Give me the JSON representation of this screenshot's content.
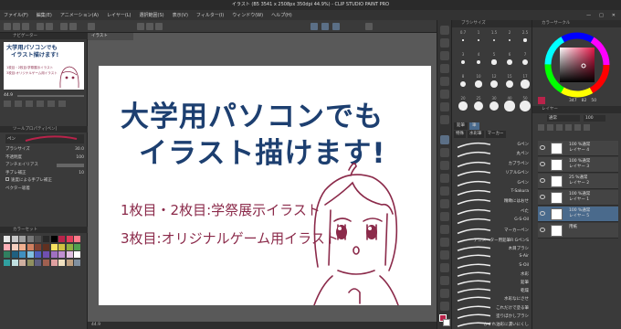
{
  "titlebar": {
    "text": "イラスト (B5 3541 x 2508px 350dpi 44.9%) - CLIP STUDIO PAINT PRO"
  },
  "menu": [
    "ファイル(F)",
    "編集(E)",
    "アニメーション(A)",
    "レイヤー(L)",
    "選択範囲(S)",
    "表示(V)",
    "フィルター(I)",
    "ウィンドウ(W)",
    "ヘルプ(H)"
  ],
  "left": {
    "navigator_title": "ナビゲーター",
    "tool_property_title": "ツールプロパティ[ペン]",
    "sub_tool_label": "ペン",
    "brush_size_label": "ブラシサイズ",
    "brush_size_value": "30.0",
    "opacity_label": "不透明度",
    "opacity_value": "100",
    "antialias_label": "アンチエイリアス",
    "stabilization_label": "手ブレ補正",
    "stabilization_value": "10",
    "speed_label": "速度による手ブレ補正",
    "vector_label": "ベクター吸着",
    "colorset_title": "カラーセット",
    "zoom_value": "44.9"
  },
  "canvas": {
    "tab_label": "イラスト",
    "title_line1": "大学用パソコンでも",
    "title_line2": "イラスト描けます!",
    "sub_line1": "1枚目・2枚目:学祭展示イラスト",
    "sub_line2": "3枚目:オリジナルゲーム用イラスト",
    "status_zoom": "44.9"
  },
  "thumb": {
    "line1": "大学用パソコンでも",
    "line2": "イラスト描けます!",
    "line3": "1枚目・2枚目:学祭展示イラスト",
    "line4": "3枚目:オリジナルゲーム用イラスト"
  },
  "brush": {
    "size_title": "ブラシサイズ",
    "sizes": [
      "0.7",
      "1",
      "1.5",
      "2",
      "2.5",
      "3",
      "4",
      "5",
      "6",
      "7",
      "8",
      "10",
      "12",
      "15",
      "17",
      "20",
      "25",
      "30",
      "40",
      "50"
    ],
    "tabs": [
      "鉛筆",
      "筆",
      "特殊",
      "水彩筆",
      "マーカー"
    ],
    "pen_items": [
      "Gペン",
      "丸ペン",
      "カブラペン",
      "リアルGペン",
      "Gペン",
      "T-Sakura",
      "精緻にはおせ",
      "べた",
      "G-S-Oil",
      "マーカーペン"
    ],
    "pen_selected": "Gペン",
    "brush_items": [
      "アニメーター用鉛筆R GペンS",
      "木目ブラシ",
      "S-Air",
      "S-Oil",
      "水彩",
      "鉛筆",
      "乾燥",
      "水彩なにさせ",
      "これだけで塗る筆",
      "塗りぼかしブラシ",
      "かすれ油彩に濃いにくし"
    ]
  },
  "color": {
    "title": "カラーサークル",
    "h": "347",
    "s": "82",
    "v": "50",
    "accent": "#b8234a"
  },
  "layers": {
    "title": "レイヤー",
    "blend": "通常",
    "opacity": "100",
    "items": [
      {
        "l1": "100 %通常",
        "l2": "レイヤー 4"
      },
      {
        "l1": "100 %通常",
        "l2": "レイヤー 3"
      },
      {
        "l1": "25 %通常",
        "l2": "レイヤー 2"
      },
      {
        "l1": "100 %通常",
        "l2": "レイヤー 1"
      },
      {
        "l1": "100 %通常",
        "l2": "レイヤー 5"
      },
      {
        "l1": "",
        "l2": "用紙"
      }
    ]
  }
}
